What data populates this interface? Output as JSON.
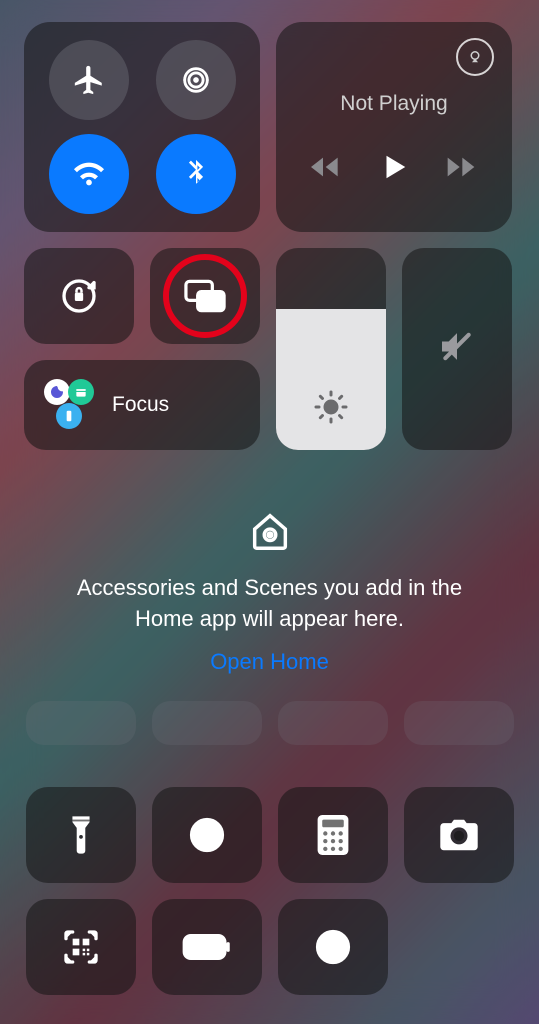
{
  "connectivity": {
    "airplane": {
      "name": "airplane-mode",
      "active": false
    },
    "cellular": {
      "name": "cellular-data",
      "active": false
    },
    "wifi": {
      "name": "wifi",
      "active": true
    },
    "bluetooth": {
      "name": "bluetooth",
      "active": true
    }
  },
  "media": {
    "title": "Not Playing",
    "airplay": "airplay"
  },
  "controls": {
    "orientation_lock": "orientation-lock",
    "screen_mirroring": "screen-mirroring",
    "focus_label": "Focus"
  },
  "brightness": {
    "level_percent": 70
  },
  "volume": {
    "level_percent": 0,
    "muted": true
  },
  "home": {
    "icon": "home",
    "message": "Accessories and Scenes you add in the Home app will appear here.",
    "link_label": "Open Home"
  },
  "shortcuts": [
    {
      "name": "flashlight",
      "icon": "flashlight-icon"
    },
    {
      "name": "timer",
      "icon": "timer-icon"
    },
    {
      "name": "calculator",
      "icon": "calculator-icon"
    },
    {
      "name": "camera",
      "icon": "camera-icon"
    },
    {
      "name": "qr-scanner",
      "icon": "qr-icon"
    },
    {
      "name": "low-power",
      "icon": "battery-icon"
    },
    {
      "name": "screen-record",
      "icon": "record-icon"
    }
  ],
  "colors": {
    "accent_blue": "#0a7aff",
    "highlight_red": "#e3021b"
  }
}
